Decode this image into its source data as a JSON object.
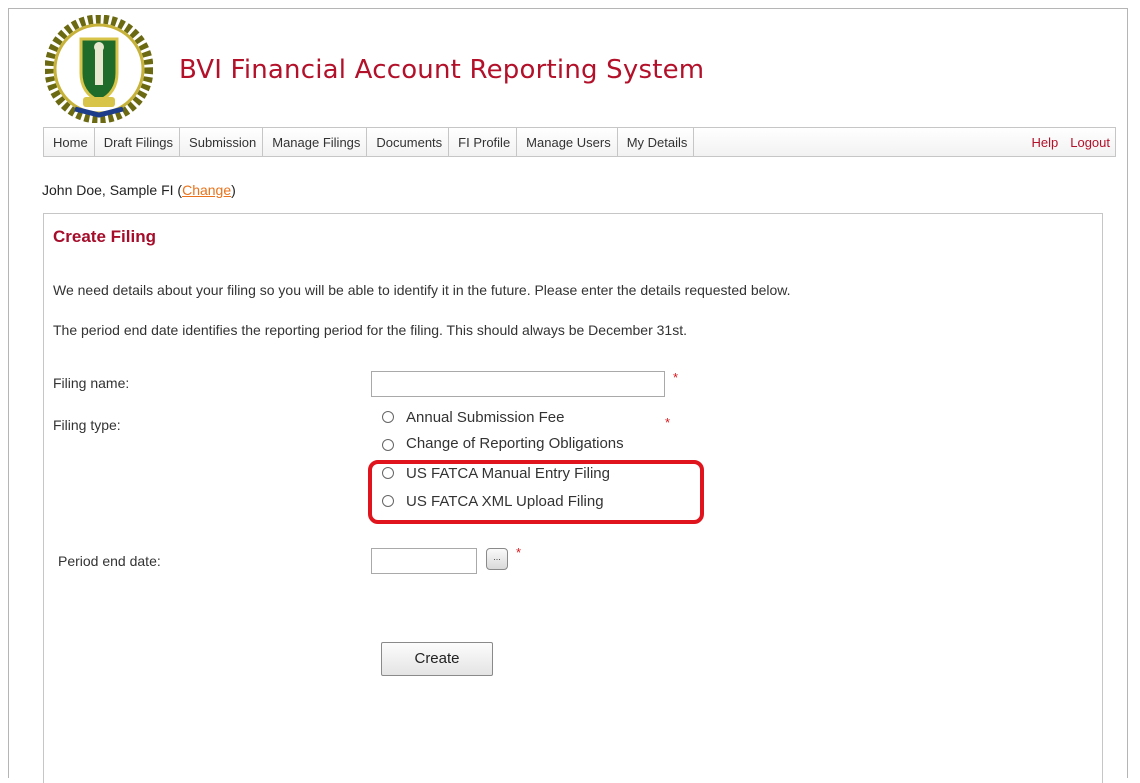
{
  "header": {
    "title": "BVI Financial Account Reporting System",
    "logo_icon": "bvi-coat-of-arms-icon"
  },
  "nav": {
    "items": [
      "Home",
      "Draft Filings",
      "Submission",
      "Manage Filings",
      "Documents",
      "FI Profile",
      "Manage Users",
      "My Details"
    ],
    "help": "Help",
    "logout": "Logout"
  },
  "user": {
    "name": "John Doe, Sample FI",
    "open_paren": "(",
    "change": "Change",
    "close_paren": ")"
  },
  "form": {
    "title": "Create Filing",
    "intro1": "We need details about your filing so you will be able to identify it in the future. Please enter the details requested below.",
    "intro2": "The period end date identifies the reporting period for the filing. This should always be December 31st.",
    "filing_name_label": "Filing name:",
    "filing_name_value": "",
    "filing_type_label": "Filing type:",
    "filing_types": [
      "Annual Submission Fee",
      "Change of Reporting Obligations",
      "US FATCA Manual Entry Filing",
      "US FATCA XML Upload Filing"
    ],
    "period_end_label": "Period end date:",
    "period_end_value": "",
    "date_button": "...",
    "required_marker": "*",
    "create_button": "Create"
  },
  "colors": {
    "brand_red": "#b3102a",
    "highlight_red": "#e0141c",
    "link_orange": "#e8731c"
  }
}
